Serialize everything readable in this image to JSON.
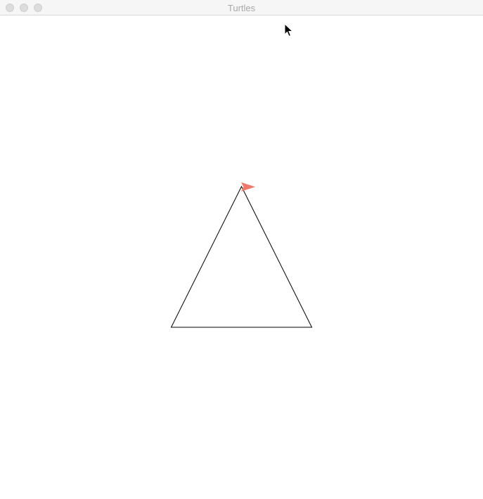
{
  "window": {
    "title": "Turtles",
    "controls": [
      "close",
      "minimize",
      "zoom"
    ]
  },
  "canvas": {
    "background": "#ffffff",
    "shape": {
      "type": "triangle",
      "stroke_color": "#000000"
    },
    "turtle": {
      "shape": "flag-arrow",
      "color": "#f07868",
      "heading": "east"
    }
  },
  "cursor": {
    "icon": "arrow-pointer-icon"
  }
}
